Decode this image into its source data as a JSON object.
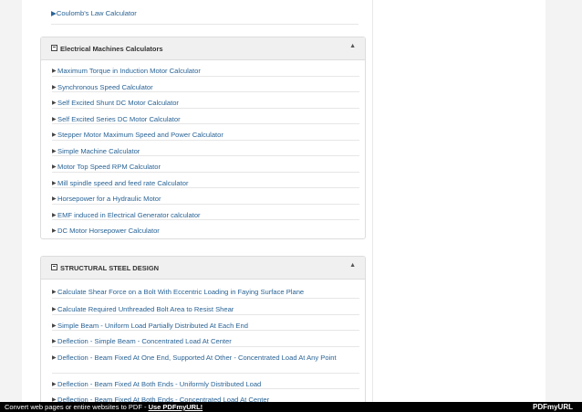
{
  "top_item": {
    "label": "Coulomb's Law Calculator"
  },
  "panels": [
    {
      "title": "Electrical Machines Calculators",
      "items": [
        "Maximum Torque in Induction Motor Calculator",
        "Synchronous Speed Calculator",
        "Self Excited Shunt DC Motor Calculator",
        "Self Excited Series DC Motor Calculator",
        "Stepper Motor Maximum Speed and Power Calculator",
        "Simple Machine Calculator",
        "Motor Top Speed RPM Calculator",
        "Mill spindle speed and feed rate Calculator",
        "Horsepower for a Hydraulic Motor",
        "EMF induced in Electrical Generator calculator",
        "DC Motor Horsepower Calculator"
      ]
    },
    {
      "title": "STRUCTURAL STEEL DESIGN",
      "items": [
        "Calculate Shear Force on a Bolt With Eccentric Loading in Faying Surface Plane",
        "Calculate Required Unthreaded Bolt Area to Resist Shear",
        "Simple Beam - Uniform Load Partially Distributed At Each End",
        "Deflection - Simple Beam - Concentrated Load At Center",
        "Deflection - Beam Fixed At One End, Supported At Other - Concentrated Load At Any Point",
        "Deflection - Beam Fixed At Both Ends - Uniformly Distributed Load",
        "Deflection - Beam Fixed At Both Ends - Concentrated Load At Center"
      ]
    }
  ],
  "footer": {
    "message": "Convert web pages or entire websites to PDF - ",
    "link_label": "Use PDFmyURL!",
    "brand": "PDFmyURL"
  }
}
